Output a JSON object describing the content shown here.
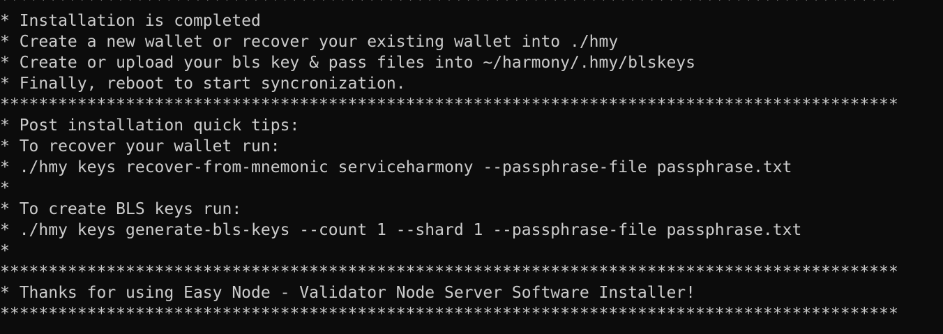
{
  "terminal": {
    "lines": [
      "*********************************************************************************************",
      "* Installation is completed",
      "* Create a new wallet or recover your existing wallet into ./hmy",
      "* Create or upload your bls key & pass files into ~/harmony/.hmy/blskeys",
      "* Finally, reboot to start syncronization.",
      "*********************************************************************************************",
      "* Post installation quick tips:",
      "* To recover your wallet run:",
      "* ./hmy keys recover-from-mnemonic serviceharmony --passphrase-file passphrase.txt",
      "*",
      "* To create BLS keys run:",
      "* ./hmy keys generate-bls-keys --count 1 --shard 1 --passphrase-file passphrase.txt",
      "*",
      "*********************************************************************************************",
      "* Thanks for using Easy Node - Validator Node Server Software Installer!",
      "*********************************************************************************************"
    ]
  }
}
